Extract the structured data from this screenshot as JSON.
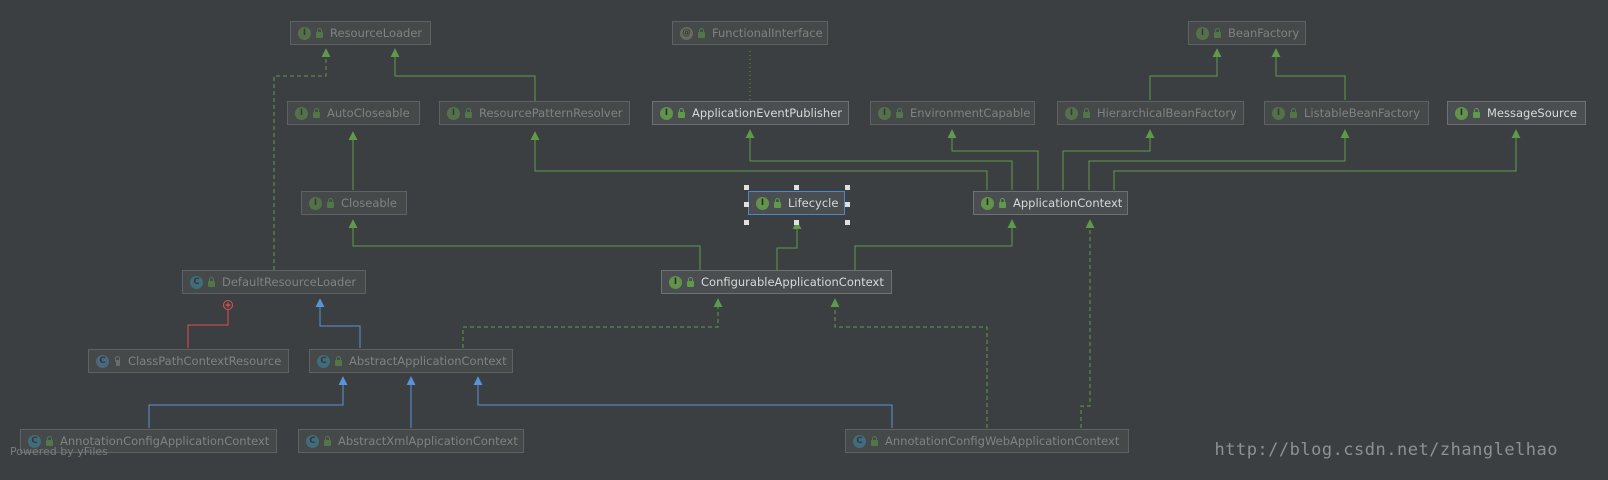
{
  "nodes": {
    "resource_loader": {
      "label": "ResourceLoader",
      "kind": "I"
    },
    "functional_interface": {
      "label": "FunctionalInterface",
      "kind": "@"
    },
    "bean_factory": {
      "label": "BeanFactory",
      "kind": "I"
    },
    "auto_closeable": {
      "label": "AutoCloseable",
      "kind": "I"
    },
    "resource_pattern_resolver": {
      "label": "ResourcePatternResolver",
      "kind": "I"
    },
    "application_event_publisher": {
      "label": "ApplicationEventPublisher",
      "kind": "I"
    },
    "environment_capable": {
      "label": "EnvironmentCapable",
      "kind": "I"
    },
    "hierarchical_bean_factory": {
      "label": "HierarchicalBeanFactory",
      "kind": "I"
    },
    "listable_bean_factory": {
      "label": "ListableBeanFactory",
      "kind": "I"
    },
    "message_source": {
      "label": "MessageSource",
      "kind": "I"
    },
    "closeable": {
      "label": "Closeable",
      "kind": "I"
    },
    "lifecycle": {
      "label": "Lifecycle",
      "kind": "I"
    },
    "application_context": {
      "label": "ApplicationContext",
      "kind": "I"
    },
    "default_resource_loader": {
      "label": "DefaultResourceLoader",
      "kind": "C"
    },
    "configurable_application_context": {
      "label": "ConfigurableApplicationContext",
      "kind": "I"
    },
    "class_path_context_resource": {
      "label": "ClassPathContextResource",
      "kind": "C"
    },
    "abstract_application_context": {
      "label": "AbstractApplicationContext",
      "kind": "C"
    },
    "annotation_config_application_context": {
      "label": "AnnotationConfigApplicationContext",
      "kind": "C"
    },
    "abstract_xml_application_context": {
      "label": "AbstractXmlApplicationContext",
      "kind": "C"
    },
    "annotation_config_web_application_context": {
      "label": "AnnotationConfigWebApplicationContext",
      "kind": "C"
    }
  },
  "footer": {
    "powered_by": "Powered by yFiles",
    "watermark": "http://blog.csdn.net/zhanglelhao"
  },
  "colors": {
    "background": "#3c3f41",
    "interface_edge": "#5f9a4a",
    "class_edge": "#5a93d8",
    "inner_edge": "#d9534f"
  }
}
